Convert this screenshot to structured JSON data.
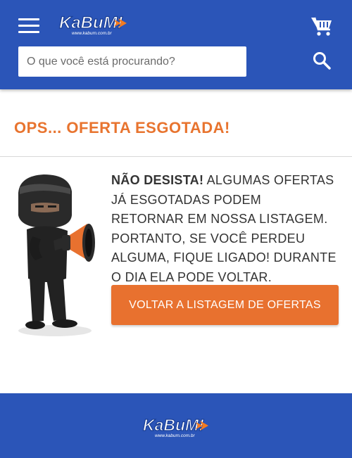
{
  "header": {
    "logo_text": "KaBuM!",
    "logo_url_text": "www.kabum.com.br",
    "menu_icon": "hamburger-menu-icon",
    "cart_icon": "shopping-cart-icon",
    "search": {
      "placeholder": "O que você está procurando?",
      "value": "",
      "icon": "search-icon"
    }
  },
  "main": {
    "title": "OPS... OFERTA ESGOTADA!",
    "message_strong": "NÃO DESISTA!",
    "message_rest": " ALGUMAS OFERTAS JÁ ESGOTADAS PODEM RETORNAR EM NOSSA LISTAGEM. PORTANTO, SE VOCÊ PERDEU ALGUMA, FIQUE LIGADO! DURANTE O DIA ELA PODE VOLTAR.",
    "button_label": "VOLTAR A LISTAGEM DE OFERTAS",
    "mascot": "ninja-mascot-with-megaphone"
  },
  "footer": {
    "logo_text": "KaBuM!",
    "logo_url_text": "www.kabum.com.br"
  },
  "colors": {
    "brand_blue": "#2b55b8",
    "accent_orange": "#e8712f"
  }
}
